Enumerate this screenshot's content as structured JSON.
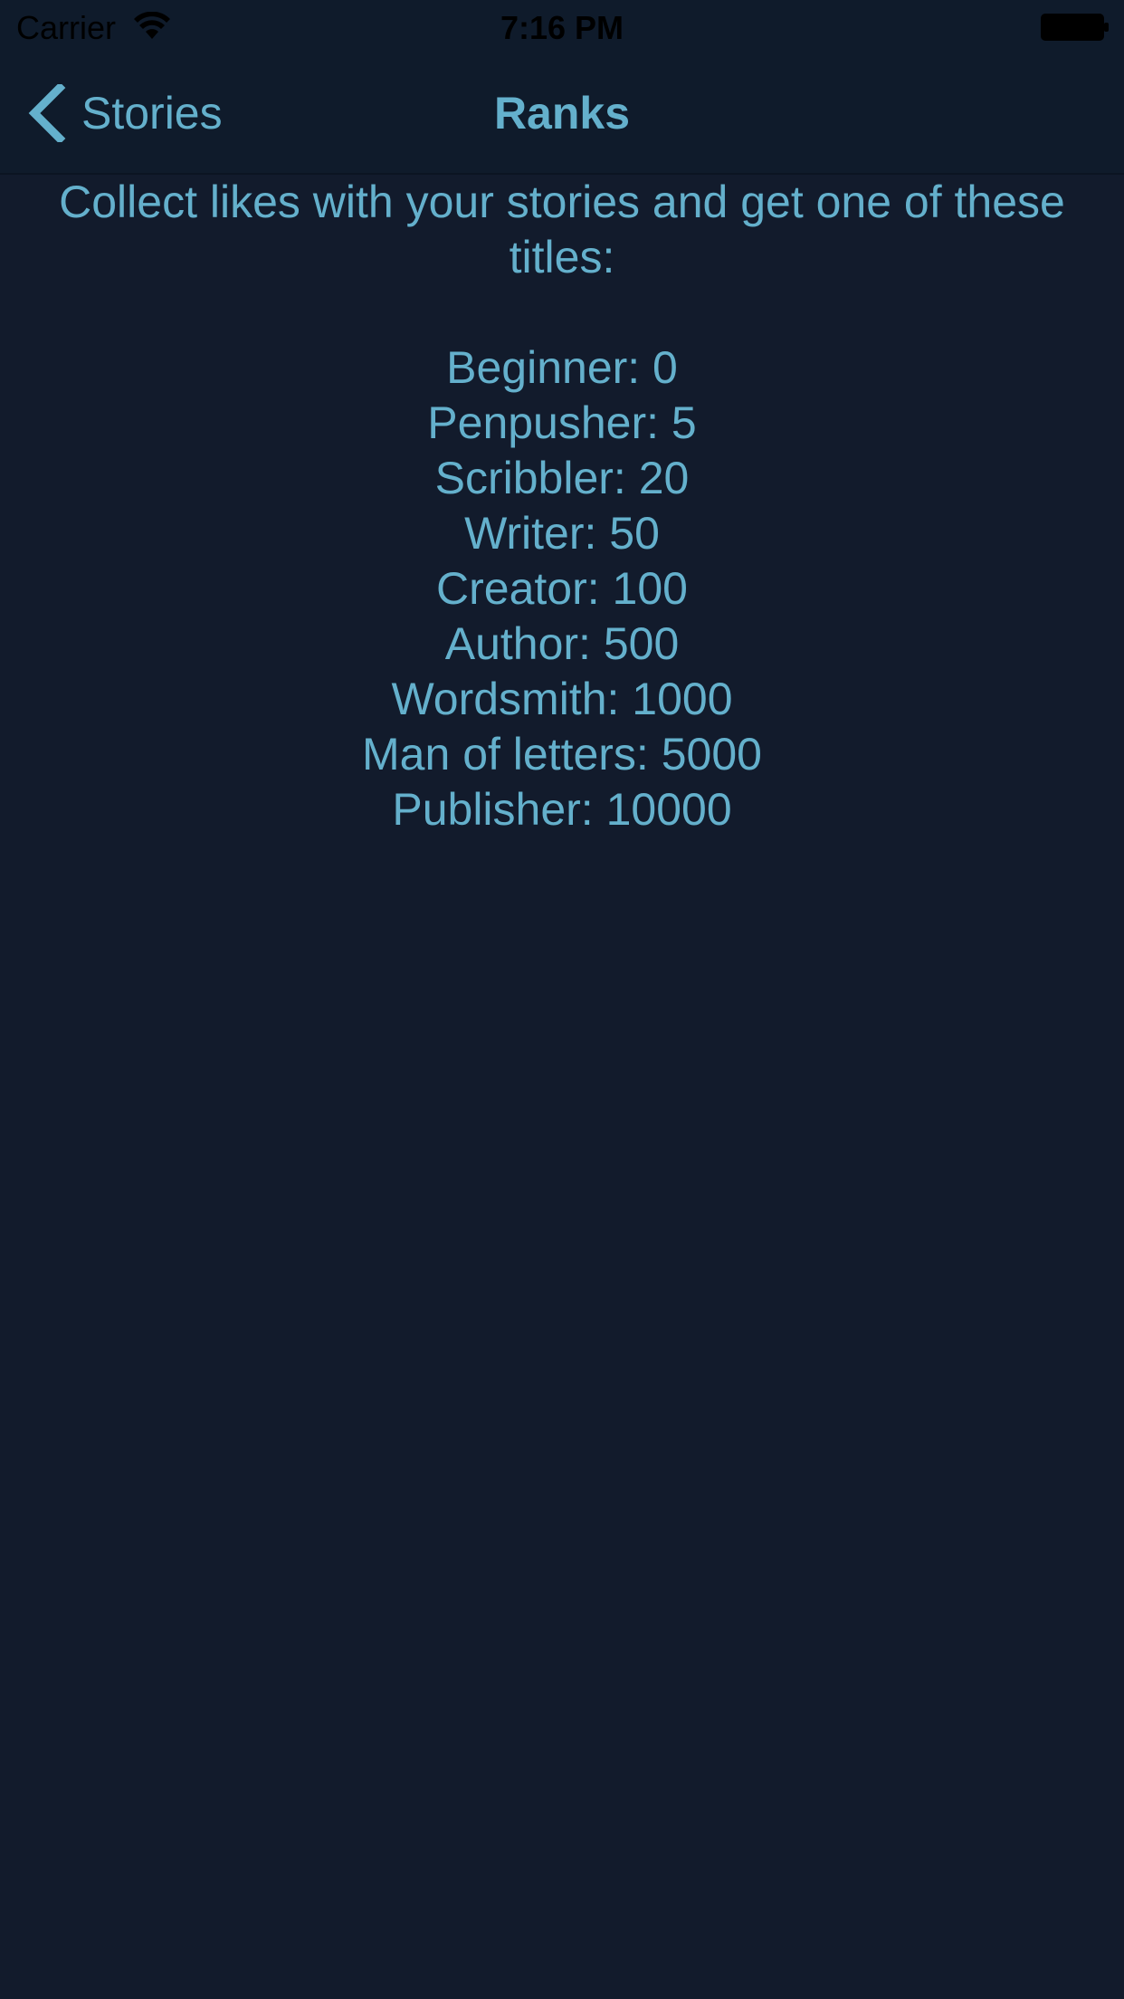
{
  "status_bar": {
    "carrier": "Carrier",
    "time": "7:16 PM",
    "wifi_icon": "wifi-icon",
    "battery_icon": "battery-icon"
  },
  "nav": {
    "back_label": "Stories",
    "back_icon": "chevron-left-icon",
    "title": "Ranks"
  },
  "content": {
    "intro": "Collect likes with your stories and get one of these titles:",
    "ranks": [
      "Beginner: 0",
      "Penpusher: 5",
      "Scribbler: 20",
      "Writer: 50",
      "Creator: 100",
      "Author: 500",
      "Wordsmith: 1000",
      "Man of letters: 5000",
      "Publisher: 10000"
    ]
  },
  "colors": {
    "background": "#121b2c",
    "bar": "#0f1b2b",
    "accent": "#64b0cc"
  }
}
